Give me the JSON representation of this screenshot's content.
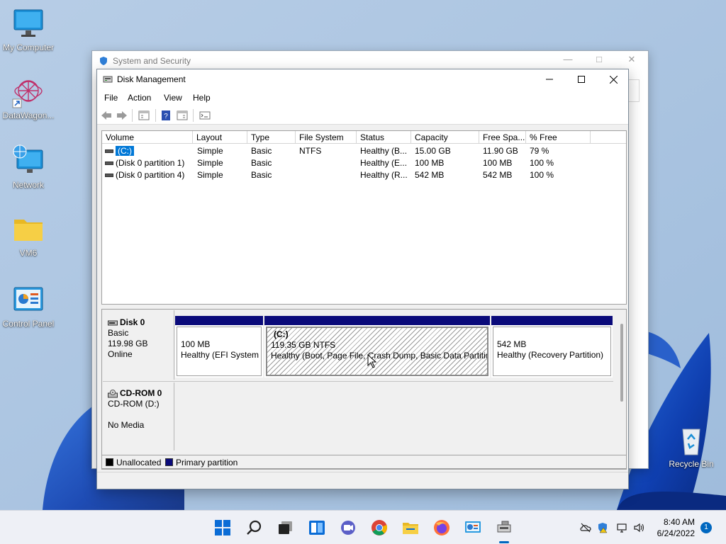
{
  "desktop": {
    "icons": [
      {
        "label": "My Computer",
        "icon": "monitor-icon"
      },
      {
        "label": "DataWagon...",
        "icon": "datawagon-shortcut-icon"
      },
      {
        "label": "Network",
        "icon": "network-icon"
      },
      {
        "label": "VM6",
        "icon": "folder-icon"
      },
      {
        "label": "Control Panel",
        "icon": "control-panel-icon"
      },
      {
        "label": "Recycle Bin",
        "icon": "recycle-bin-icon"
      }
    ]
  },
  "bg_window": {
    "title": "System and Security"
  },
  "window": {
    "title": "Disk Management",
    "menu": [
      "File",
      "Action",
      "View",
      "Help"
    ]
  },
  "volumes": {
    "columns": [
      "Volume",
      "Layout",
      "Type",
      "File System",
      "Status",
      "Capacity",
      "Free Spa...",
      "% Free"
    ],
    "rows": [
      {
        "volume": "(C:)",
        "layout": "Simple",
        "type": "Basic",
        "fs": "NTFS",
        "status": "Healthy (B...",
        "capacity": "15.00 GB",
        "free": "11.90 GB",
        "pct": "79 %"
      },
      {
        "volume": "(Disk 0 partition 1)",
        "layout": "Simple",
        "type": "Basic",
        "fs": "",
        "status": "Healthy (E...",
        "capacity": "100 MB",
        "free": "100 MB",
        "pct": "100 %"
      },
      {
        "volume": "(Disk 0 partition 4)",
        "layout": "Simple",
        "type": "Basic",
        "fs": "",
        "status": "Healthy (R...",
        "capacity": "542 MB",
        "free": "542 MB",
        "pct": "100 %"
      }
    ]
  },
  "disks": {
    "disk0": {
      "name": "Disk 0",
      "type": "Basic",
      "size": "119.98 GB",
      "state": "Online",
      "partitions": [
        {
          "title": "",
          "size": "100 MB",
          "status": "Healthy (EFI System I"
        },
        {
          "title": "(C:)",
          "size": "119.35 GB NTFS",
          "status": "Healthy (Boot, Page File, Crash Dump, Basic Data Partition)"
        },
        {
          "title": "",
          "size": "542 MB",
          "status": "Healthy (Recovery Partition)"
        }
      ]
    },
    "cdrom0": {
      "name": "CD-ROM 0",
      "drive": "CD-ROM (D:)",
      "media": "No Media"
    }
  },
  "legend": [
    {
      "label": "Unallocated",
      "color": "#000000"
    },
    {
      "label": "Primary partition",
      "color": "#0a0a7a"
    }
  ],
  "taskbar": {
    "apps": [
      "start-icon",
      "search-icon",
      "task-view-icon",
      "widgets-icon",
      "chat-icon",
      "chrome-icon",
      "file-explorer-icon",
      "firefox-icon",
      "control-panel-icon",
      "disk-management-icon"
    ],
    "time": "8:40 AM",
    "date": "6/24/2022",
    "notifications": "1"
  }
}
